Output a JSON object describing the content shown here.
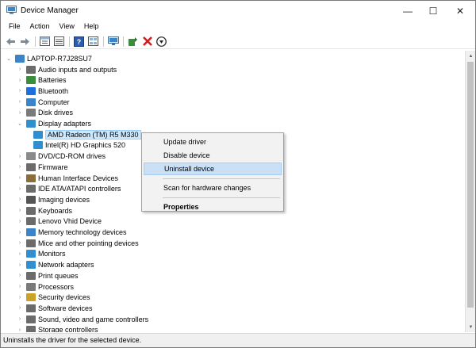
{
  "window": {
    "title": "Device Manager",
    "minimize": "—",
    "maximize": "☐",
    "close": "✕"
  },
  "menu": [
    "File",
    "Action",
    "View",
    "Help"
  ],
  "toolbar": [
    "back-icon",
    "forward-icon",
    "properties-icon",
    "list-icon",
    "help-icon",
    "view-icon",
    "monitor-icon",
    "update-driver-icon",
    "uninstall-icon",
    "download-icon"
  ],
  "tree": {
    "root": "LAPTOP-R7J28SU7",
    "items": [
      {
        "label": "Audio inputs and outputs",
        "level": 1,
        "expanded": false,
        "color": "#6b6b6b"
      },
      {
        "label": "Batteries",
        "level": 1,
        "expanded": false,
        "color": "#3a8d3a"
      },
      {
        "label": "Bluetooth",
        "level": 1,
        "expanded": false,
        "color": "#1e6fd9"
      },
      {
        "label": "Computer",
        "level": 1,
        "expanded": false,
        "color": "#3a84c9"
      },
      {
        "label": "Disk drives",
        "level": 1,
        "expanded": false,
        "color": "#7a7a7a"
      },
      {
        "label": "Display adapters",
        "level": 1,
        "expanded": true,
        "color": "#2f8fcf"
      },
      {
        "label": "AMD Radeon (TM) R5 M330",
        "level": 2,
        "selected": true,
        "color": "#2f8fcf"
      },
      {
        "label": "Intel(R) HD Graphics 520",
        "level": 2,
        "color": "#2f8fcf"
      },
      {
        "label": "DVD/CD-ROM drives",
        "level": 1,
        "expanded": false,
        "color": "#8a8a8a"
      },
      {
        "label": "Firmware",
        "level": 1,
        "expanded": false,
        "color": "#6b6b6b"
      },
      {
        "label": "Human Interface Devices",
        "level": 1,
        "expanded": false,
        "color": "#8a6d3b"
      },
      {
        "label": "IDE ATA/ATAPI controllers",
        "level": 1,
        "expanded": false,
        "color": "#6b6b6b"
      },
      {
        "label": "Imaging devices",
        "level": 1,
        "expanded": false,
        "color": "#555555"
      },
      {
        "label": "Keyboards",
        "level": 1,
        "expanded": false,
        "color": "#6b6b6b"
      },
      {
        "label": "Lenovo Vhid Device",
        "level": 1,
        "expanded": false,
        "color": "#6b6b6b"
      },
      {
        "label": "Memory technology devices",
        "level": 1,
        "expanded": false,
        "color": "#3a84c9"
      },
      {
        "label": "Mice and other pointing devices",
        "level": 1,
        "expanded": false,
        "color": "#6b6b6b"
      },
      {
        "label": "Monitors",
        "level": 1,
        "expanded": false,
        "color": "#2f8fcf"
      },
      {
        "label": "Network adapters",
        "level": 1,
        "expanded": false,
        "color": "#2f8fcf"
      },
      {
        "label": "Print queues",
        "level": 1,
        "expanded": false,
        "color": "#6b6b6b"
      },
      {
        "label": "Processors",
        "level": 1,
        "expanded": false,
        "color": "#7a7a7a"
      },
      {
        "label": "Security devices",
        "level": 1,
        "expanded": false,
        "color": "#c9a227"
      },
      {
        "label": "Software devices",
        "level": 1,
        "expanded": false,
        "color": "#6b6b6b"
      },
      {
        "label": "Sound, video and game controllers",
        "level": 1,
        "expanded": false,
        "color": "#6b6b6b"
      },
      {
        "label": "Storage controllers",
        "level": 1,
        "expanded": false,
        "color": "#6b6b6b"
      }
    ]
  },
  "context_menu": {
    "items": [
      {
        "label": "Update driver",
        "hover": false,
        "bold": false
      },
      {
        "label": "Disable device",
        "hover": false,
        "bold": false
      },
      {
        "label": "Uninstall device",
        "hover": true,
        "bold": false
      },
      {
        "separator": true
      },
      {
        "label": "Scan for hardware changes",
        "hover": false,
        "bold": false
      },
      {
        "separator": true
      },
      {
        "label": "Properties",
        "hover": false,
        "bold": true
      }
    ]
  },
  "statusbar": {
    "text": "Uninstalls the driver for the selected device."
  },
  "scrollbar": {
    "up": "▲",
    "down": "▼"
  },
  "colors": {
    "selection_bg": "#cce8ff",
    "menu_hover_bg": "#c9e0f7"
  }
}
